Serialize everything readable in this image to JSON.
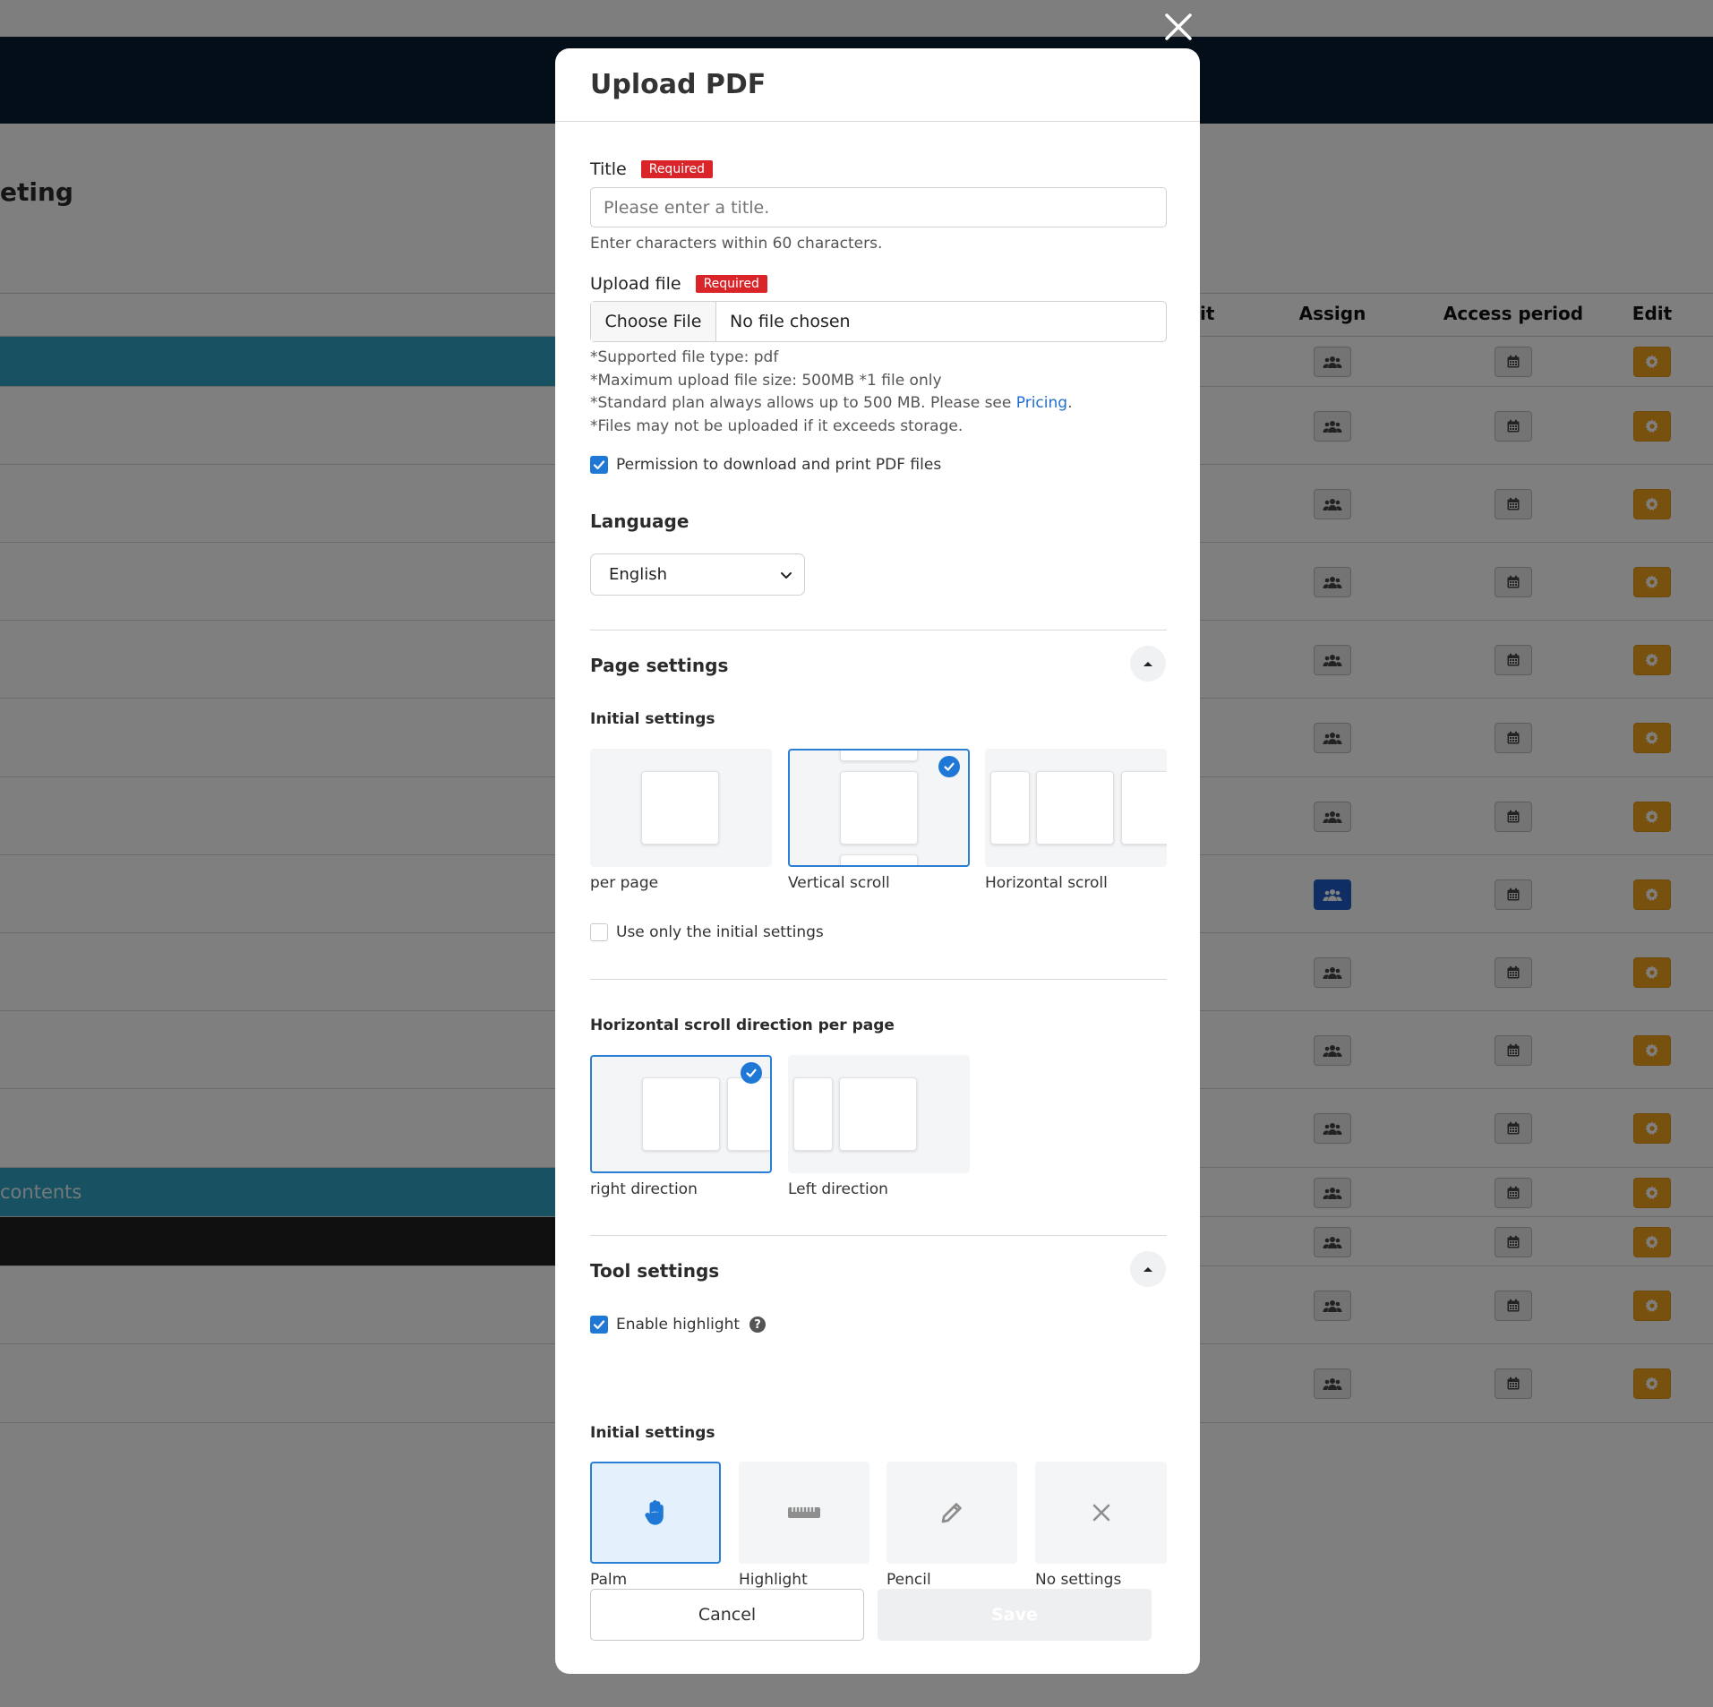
{
  "background": {
    "page_title_fragment": "eting",
    "table_headers": {
      "edit_fragment": "it",
      "assign": "Assign",
      "access_period": "Access period",
      "edit": "Edit"
    },
    "contents_row_label": "contents"
  },
  "modal": {
    "title": "Upload PDF",
    "title_field": {
      "label": "Title",
      "required_badge": "Required",
      "placeholder": "Please enter a title.",
      "value": "",
      "hint": "Enter characters within 60 characters."
    },
    "upload_field": {
      "label": "Upload file",
      "required_badge": "Required",
      "choose_button": "Choose File",
      "file_status": "No file chosen",
      "notes": [
        "*Supported file type: pdf",
        "*Maximum upload file size: 500MB *1 file only",
        "*Standard plan always allows up to 500 MB. Please see ",
        "*Files may not be uploaded if it exceeds storage."
      ],
      "pricing_link": "Pricing",
      "pricing_suffix": "."
    },
    "download_permission": {
      "label": "Permission to download and print PDF files",
      "checked": true
    },
    "language": {
      "label": "Language",
      "selected": "English"
    },
    "page_settings": {
      "title": "Page settings",
      "initial_settings_label": "Initial settings",
      "options": [
        "per page",
        "Vertical scroll",
        "Horizontal scroll"
      ],
      "selected": "Vertical scroll",
      "use_only_initial": {
        "label": "Use only the initial settings",
        "checked": false
      },
      "direction_title": "Horizontal scroll direction per page",
      "direction_options": [
        "right direction",
        "Left direction"
      ],
      "direction_selected": "right direction"
    },
    "tool_settings": {
      "title": "Tool settings",
      "enable_highlight": {
        "label": "Enable highlight",
        "checked": true
      },
      "initial_settings_label": "Initial settings",
      "tools": [
        {
          "label": "Palm",
          "icon": "hand-icon"
        },
        {
          "label": "Highlight",
          "icon": "highlighter-icon"
        },
        {
          "label": "Pencil",
          "icon": "pencil-icon"
        },
        {
          "label": "No settings",
          "icon": "x-icon"
        }
      ],
      "selected_tool": "Palm"
    },
    "buttons": {
      "cancel": "Cancel",
      "save": "Save"
    }
  },
  "colors": {
    "accent_blue": "#1f78d6",
    "required_red": "#d9252a",
    "header_navy": "#071d33",
    "row_teal": "#2ea3c5",
    "edit_orange": "#f0a21c"
  }
}
